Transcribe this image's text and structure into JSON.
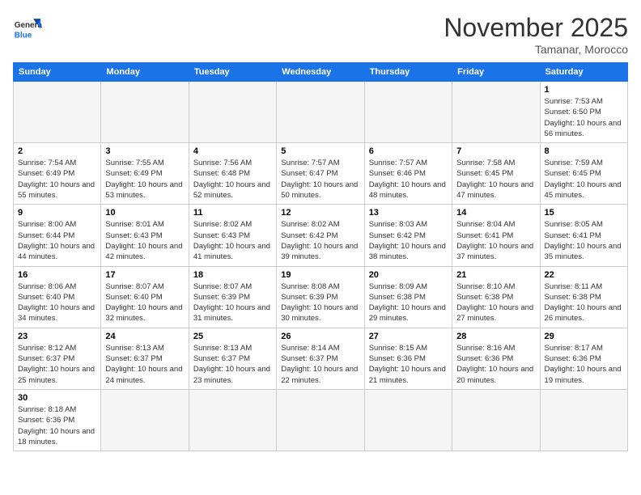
{
  "header": {
    "logo_general": "General",
    "logo_blue": "Blue",
    "month_title": "November 2025",
    "subtitle": "Tamanar, Morocco"
  },
  "weekdays": [
    "Sunday",
    "Monday",
    "Tuesday",
    "Wednesday",
    "Thursday",
    "Friday",
    "Saturday"
  ],
  "weeks": [
    [
      {
        "day": "",
        "info": ""
      },
      {
        "day": "",
        "info": ""
      },
      {
        "day": "",
        "info": ""
      },
      {
        "day": "",
        "info": ""
      },
      {
        "day": "",
        "info": ""
      },
      {
        "day": "",
        "info": ""
      },
      {
        "day": "1",
        "info": "Sunrise: 7:53 AM\nSunset: 6:50 PM\nDaylight: 10 hours and 56 minutes."
      }
    ],
    [
      {
        "day": "2",
        "info": "Sunrise: 7:54 AM\nSunset: 6:49 PM\nDaylight: 10 hours and 55 minutes."
      },
      {
        "day": "3",
        "info": "Sunrise: 7:55 AM\nSunset: 6:49 PM\nDaylight: 10 hours and 53 minutes."
      },
      {
        "day": "4",
        "info": "Sunrise: 7:56 AM\nSunset: 6:48 PM\nDaylight: 10 hours and 52 minutes."
      },
      {
        "day": "5",
        "info": "Sunrise: 7:57 AM\nSunset: 6:47 PM\nDaylight: 10 hours and 50 minutes."
      },
      {
        "day": "6",
        "info": "Sunrise: 7:57 AM\nSunset: 6:46 PM\nDaylight: 10 hours and 48 minutes."
      },
      {
        "day": "7",
        "info": "Sunrise: 7:58 AM\nSunset: 6:45 PM\nDaylight: 10 hours and 47 minutes."
      },
      {
        "day": "8",
        "info": "Sunrise: 7:59 AM\nSunset: 6:45 PM\nDaylight: 10 hours and 45 minutes."
      }
    ],
    [
      {
        "day": "9",
        "info": "Sunrise: 8:00 AM\nSunset: 6:44 PM\nDaylight: 10 hours and 44 minutes."
      },
      {
        "day": "10",
        "info": "Sunrise: 8:01 AM\nSunset: 6:43 PM\nDaylight: 10 hours and 42 minutes."
      },
      {
        "day": "11",
        "info": "Sunrise: 8:02 AM\nSunset: 6:43 PM\nDaylight: 10 hours and 41 minutes."
      },
      {
        "day": "12",
        "info": "Sunrise: 8:02 AM\nSunset: 6:42 PM\nDaylight: 10 hours and 39 minutes."
      },
      {
        "day": "13",
        "info": "Sunrise: 8:03 AM\nSunset: 6:42 PM\nDaylight: 10 hours and 38 minutes."
      },
      {
        "day": "14",
        "info": "Sunrise: 8:04 AM\nSunset: 6:41 PM\nDaylight: 10 hours and 37 minutes."
      },
      {
        "day": "15",
        "info": "Sunrise: 8:05 AM\nSunset: 6:41 PM\nDaylight: 10 hours and 35 minutes."
      }
    ],
    [
      {
        "day": "16",
        "info": "Sunrise: 8:06 AM\nSunset: 6:40 PM\nDaylight: 10 hours and 34 minutes."
      },
      {
        "day": "17",
        "info": "Sunrise: 8:07 AM\nSunset: 6:40 PM\nDaylight: 10 hours and 32 minutes."
      },
      {
        "day": "18",
        "info": "Sunrise: 8:07 AM\nSunset: 6:39 PM\nDaylight: 10 hours and 31 minutes."
      },
      {
        "day": "19",
        "info": "Sunrise: 8:08 AM\nSunset: 6:39 PM\nDaylight: 10 hours and 30 minutes."
      },
      {
        "day": "20",
        "info": "Sunrise: 8:09 AM\nSunset: 6:38 PM\nDaylight: 10 hours and 29 minutes."
      },
      {
        "day": "21",
        "info": "Sunrise: 8:10 AM\nSunset: 6:38 PM\nDaylight: 10 hours and 27 minutes."
      },
      {
        "day": "22",
        "info": "Sunrise: 8:11 AM\nSunset: 6:38 PM\nDaylight: 10 hours and 26 minutes."
      }
    ],
    [
      {
        "day": "23",
        "info": "Sunrise: 8:12 AM\nSunset: 6:37 PM\nDaylight: 10 hours and 25 minutes."
      },
      {
        "day": "24",
        "info": "Sunrise: 8:13 AM\nSunset: 6:37 PM\nDaylight: 10 hours and 24 minutes."
      },
      {
        "day": "25",
        "info": "Sunrise: 8:13 AM\nSunset: 6:37 PM\nDaylight: 10 hours and 23 minutes."
      },
      {
        "day": "26",
        "info": "Sunrise: 8:14 AM\nSunset: 6:37 PM\nDaylight: 10 hours and 22 minutes."
      },
      {
        "day": "27",
        "info": "Sunrise: 8:15 AM\nSunset: 6:36 PM\nDaylight: 10 hours and 21 minutes."
      },
      {
        "day": "28",
        "info": "Sunrise: 8:16 AM\nSunset: 6:36 PM\nDaylight: 10 hours and 20 minutes."
      },
      {
        "day": "29",
        "info": "Sunrise: 8:17 AM\nSunset: 6:36 PM\nDaylight: 10 hours and 19 minutes."
      }
    ],
    [
      {
        "day": "30",
        "info": "Sunrise: 8:18 AM\nSunset: 6:36 PM\nDaylight: 10 hours and 18 minutes."
      },
      {
        "day": "",
        "info": ""
      },
      {
        "day": "",
        "info": ""
      },
      {
        "day": "",
        "info": ""
      },
      {
        "day": "",
        "info": ""
      },
      {
        "day": "",
        "info": ""
      },
      {
        "day": "",
        "info": ""
      }
    ]
  ]
}
